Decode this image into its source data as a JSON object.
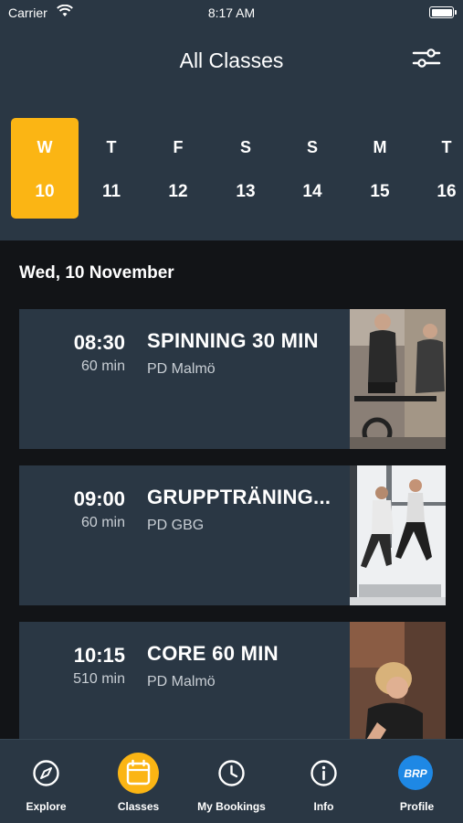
{
  "status_bar": {
    "carrier": "Carrier",
    "time": "8:17 AM"
  },
  "header": {
    "title": "All Classes",
    "filter_icon": "sliders-icon"
  },
  "days": [
    {
      "letter": "W",
      "number": "10",
      "selected": true
    },
    {
      "letter": "T",
      "number": "11",
      "selected": false
    },
    {
      "letter": "F",
      "number": "12",
      "selected": false
    },
    {
      "letter": "S",
      "number": "13",
      "selected": false
    },
    {
      "letter": "S",
      "number": "14",
      "selected": false
    },
    {
      "letter": "M",
      "number": "15",
      "selected": false
    },
    {
      "letter": "T",
      "number": "16",
      "selected": false
    }
  ],
  "date_heading": "Wed, 10 November",
  "classes": [
    {
      "time": "08:30",
      "duration": "60 min",
      "name": "SPINNING 30 MIN",
      "location": "PD Malmö",
      "image": "spinning-photo"
    },
    {
      "time": "09:00",
      "duration": "60 min",
      "name": "GRUPPTRÄNING...",
      "location": "PD GBG",
      "image": "group-training-photo"
    },
    {
      "time": "10:15",
      "duration": "510 min",
      "name": "CORE 60 MIN",
      "location": "PD Malmö",
      "image": "core-photo"
    }
  ],
  "tabs": [
    {
      "label": "Explore",
      "icon": "compass-icon",
      "active": false
    },
    {
      "label": "Classes",
      "icon": "calendar-icon",
      "active": true
    },
    {
      "label": "My Bookings",
      "icon": "clock-icon",
      "active": false
    },
    {
      "label": "Info",
      "icon": "info-icon",
      "active": false
    },
    {
      "label": "Profile",
      "icon": "brp-logo",
      "logo_text": "BRP",
      "active": false
    }
  ],
  "colors": {
    "header_bg": "#2a3744",
    "accent": "#fbb514",
    "body_bg": "#121417"
  }
}
